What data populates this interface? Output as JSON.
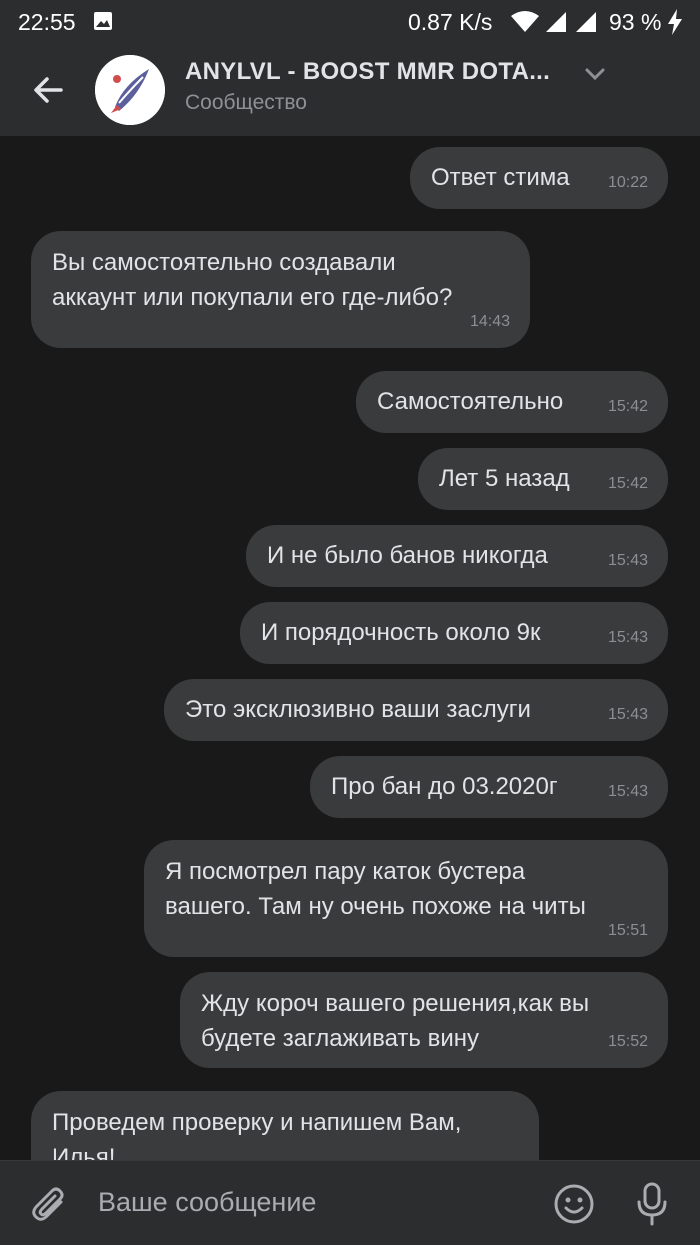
{
  "status_bar": {
    "time": "22:55",
    "speed": "0.87 K/s",
    "battery": "93 %"
  },
  "header": {
    "title": "ANYLVL - BOOST MMR DOTA...",
    "subtitle": "Сообщество",
    "avatar_icon": "rocket-logo-icon",
    "back_icon": "arrow-left-icon",
    "dropdown_icon": "chevron-down-icon"
  },
  "messages": [
    {
      "side": "out",
      "lines": [
        "Ответ стима"
      ],
      "time": "10:22"
    },
    {
      "side": "in",
      "lines": [
        "Вы самостоятельно создавали",
        "аккаунт или покупали его где-либо?"
      ],
      "time": "14:43"
    },
    {
      "side": "out",
      "lines": [
        "Самостоятельно"
      ],
      "time": "15:42"
    },
    {
      "side": "out",
      "lines": [
        "Лет 5 назад"
      ],
      "time": "15:42"
    },
    {
      "side": "out",
      "lines": [
        "И не было банов никогда"
      ],
      "time": "15:43"
    },
    {
      "side": "out",
      "lines": [
        "И порядочность около 9к"
      ],
      "time": "15:43"
    },
    {
      "side": "out",
      "lines": [
        "Это эксклюзивно ваши заслуги"
      ],
      "time": "15:43"
    },
    {
      "side": "out",
      "lines": [
        "Про бан до 03.2020г"
      ],
      "time": "15:43"
    },
    {
      "side": "out",
      "lines": [
        "Я посмотрел пару каток бустера",
        "вашего. Там ну очень похоже на читы"
      ],
      "time": "15:51"
    },
    {
      "side": "out",
      "lines": [
        "Жду короч вашего решения,как вы",
        "будете заглаживать вину"
      ],
      "time": "15:52"
    },
    {
      "side": "in",
      "lines": [
        "Проведем проверку и напишем Вам,",
        "Илья!"
      ],
      "time": ""
    }
  ],
  "composer": {
    "placeholder": "Ваше сообщение",
    "attach_icon": "paperclip-icon",
    "emoji_icon": "smile-icon",
    "mic_icon": "microphone-icon"
  },
  "colors": {
    "background": "#19191a",
    "bar": "#2c2d2e",
    "bubble": "#3a3b3c",
    "text": "#e1e3e6",
    "muted": "#8b8e92"
  }
}
